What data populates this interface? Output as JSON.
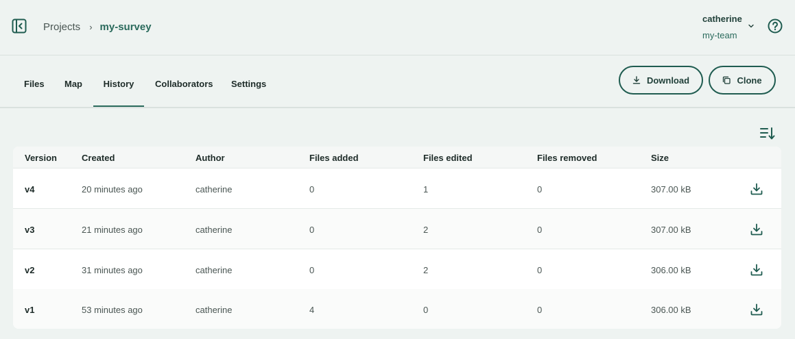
{
  "breadcrumb": {
    "projects": "Projects",
    "separator": "›",
    "current": "my-survey"
  },
  "user": {
    "name": "catherine",
    "team": "my-team"
  },
  "tabs": [
    {
      "label": "Files"
    },
    {
      "label": "Map"
    },
    {
      "label": "History",
      "active": true
    },
    {
      "label": "Collaborators"
    },
    {
      "label": "Settings"
    }
  ],
  "actions": {
    "download_label": "Download",
    "clone_label": "Clone"
  },
  "table": {
    "headers": [
      "Version",
      "Created",
      "Author",
      "Files added",
      "Files edited",
      "Files removed",
      "Size"
    ],
    "rows": [
      {
        "version": "v4",
        "created": "20 minutes ago",
        "author": "catherine",
        "added": "0",
        "edited": "1",
        "removed": "0",
        "size": "307.00 kB"
      },
      {
        "version": "v3",
        "created": "21 minutes ago",
        "author": "catherine",
        "added": "0",
        "edited": "2",
        "removed": "0",
        "size": "307.00 kB"
      },
      {
        "version": "v2",
        "created": "31 minutes ago",
        "author": "catherine",
        "added": "0",
        "edited": "2",
        "removed": "0",
        "size": "306.00 kB"
      },
      {
        "version": "v1",
        "created": "53 minutes ago",
        "author": "catherine",
        "added": "4",
        "edited": "0",
        "removed": "0",
        "size": "306.00 kB"
      }
    ]
  },
  "icons": {
    "sidebar_toggle": "sidebar-collapse-icon",
    "help": "help-circle-icon",
    "user_menu": "chevron-down-icon",
    "download": "download-icon",
    "clone": "copy-icon",
    "sort": "sort-descending-icon",
    "row_download": "download-icon"
  },
  "colors": {
    "background": "#eef3f1",
    "accent": "#2a6a5c",
    "button_border": "#1f5c50",
    "text": "#1d2b28"
  }
}
